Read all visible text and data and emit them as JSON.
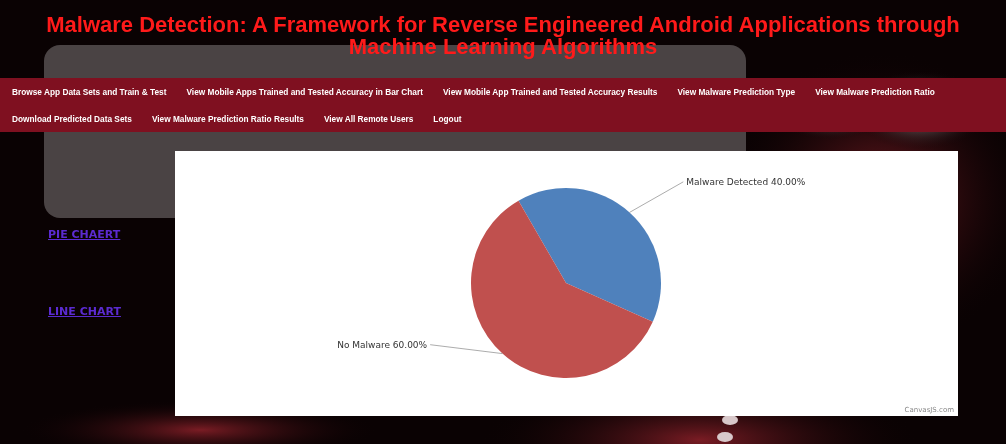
{
  "title": "Malware Detection: A Framework for Reverse Engineered Android Applications through Machine Learning Algorithms",
  "nav": [
    "Browse App Data Sets and Train & Test",
    "View Mobile Apps Trained and Tested Accuracy in Bar Chart",
    "View Mobile App Trained and Tested Accuracy Results",
    "View Malware Prediction Type",
    "View Malware Prediction Ratio",
    "Download Predicted Data Sets",
    "View Malware Prediction Ratio Results",
    "View All Remote Users",
    "Logout"
  ],
  "side_links": [
    "PIE CHAERT",
    "LINE CHART"
  ],
  "chart": {
    "credit": "CanvasJS.com",
    "chart_data": {
      "type": "pie",
      "categories": [
        "Malware Detected",
        "No Malware"
      ],
      "values": [
        40,
        60
      ],
      "colors": [
        "#4f81bc",
        "#c0504e"
      ],
      "value_labels": [
        "40.00%",
        "60.00%"
      ]
    }
  }
}
